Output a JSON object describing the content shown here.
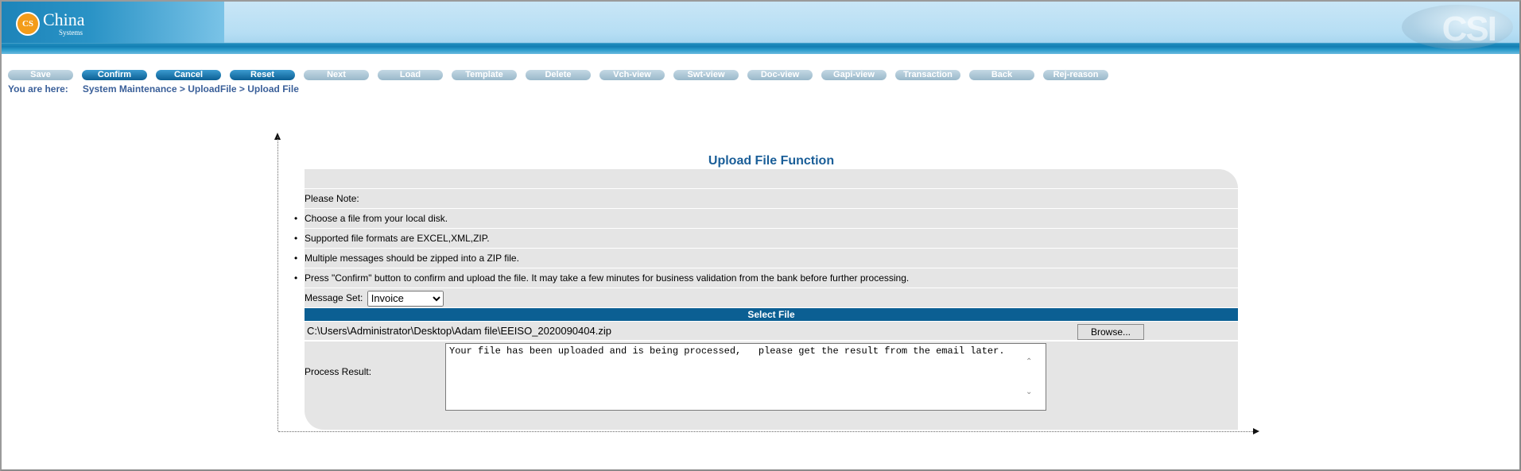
{
  "app": {
    "logo_text": "China",
    "logo_sub": "Systems",
    "logo_mark": "CS",
    "watermark_text": "CSI"
  },
  "colors": {
    "accent": "#0b5f93",
    "breadcrumb": "#3a5f99",
    "panel_bg": "#e5e5e5",
    "title": "#1a5e98"
  },
  "toolbar": {
    "buttons": [
      {
        "label": "Save",
        "enabled": false
      },
      {
        "label": "Confirm",
        "enabled": true
      },
      {
        "label": "Cancel",
        "enabled": true
      },
      {
        "label": "Reset",
        "enabled": true
      },
      {
        "label": "Next",
        "enabled": false
      },
      {
        "label": "Load",
        "enabled": false
      },
      {
        "label": "Template",
        "enabled": false
      },
      {
        "label": "Delete",
        "enabled": false
      },
      {
        "label": "Vch-view",
        "enabled": false
      },
      {
        "label": "Swt-view",
        "enabled": false
      },
      {
        "label": "Doc-view",
        "enabled": false
      },
      {
        "label": "Gapi-view",
        "enabled": false
      },
      {
        "label": "Transaction",
        "enabled": false
      },
      {
        "label": "Back",
        "enabled": false
      },
      {
        "label": "Rej-reason",
        "enabled": false
      }
    ]
  },
  "breadcrumb": {
    "prefix": "You are here:",
    "path": "System Maintenance > UploadFile > Upload File"
  },
  "form": {
    "title": "Upload File Function",
    "note_label": "Please Note:",
    "notes": [
      "Choose a file from your local disk.",
      "Supported file formats are EXCEL,XML,ZIP.",
      "Multiple messages should be zipped into a ZIP file.",
      "Press \"Confirm\" button to confirm and upload the file. It may take a few minutes for business validation from the bank before further processing."
    ],
    "bullet": "•",
    "message_set_label": "Message Set:",
    "message_set_value": "Invoice",
    "select_file_header": "Select File",
    "file_path": "C:\\Users\\Administrator\\Desktop\\Adam file\\EEISO_2020090404.zip",
    "browse_label": "Browse...",
    "process_result_label": "Process Result:",
    "process_result_text": "Your file has been uploaded and is being processed,   please get the result from the email later."
  }
}
